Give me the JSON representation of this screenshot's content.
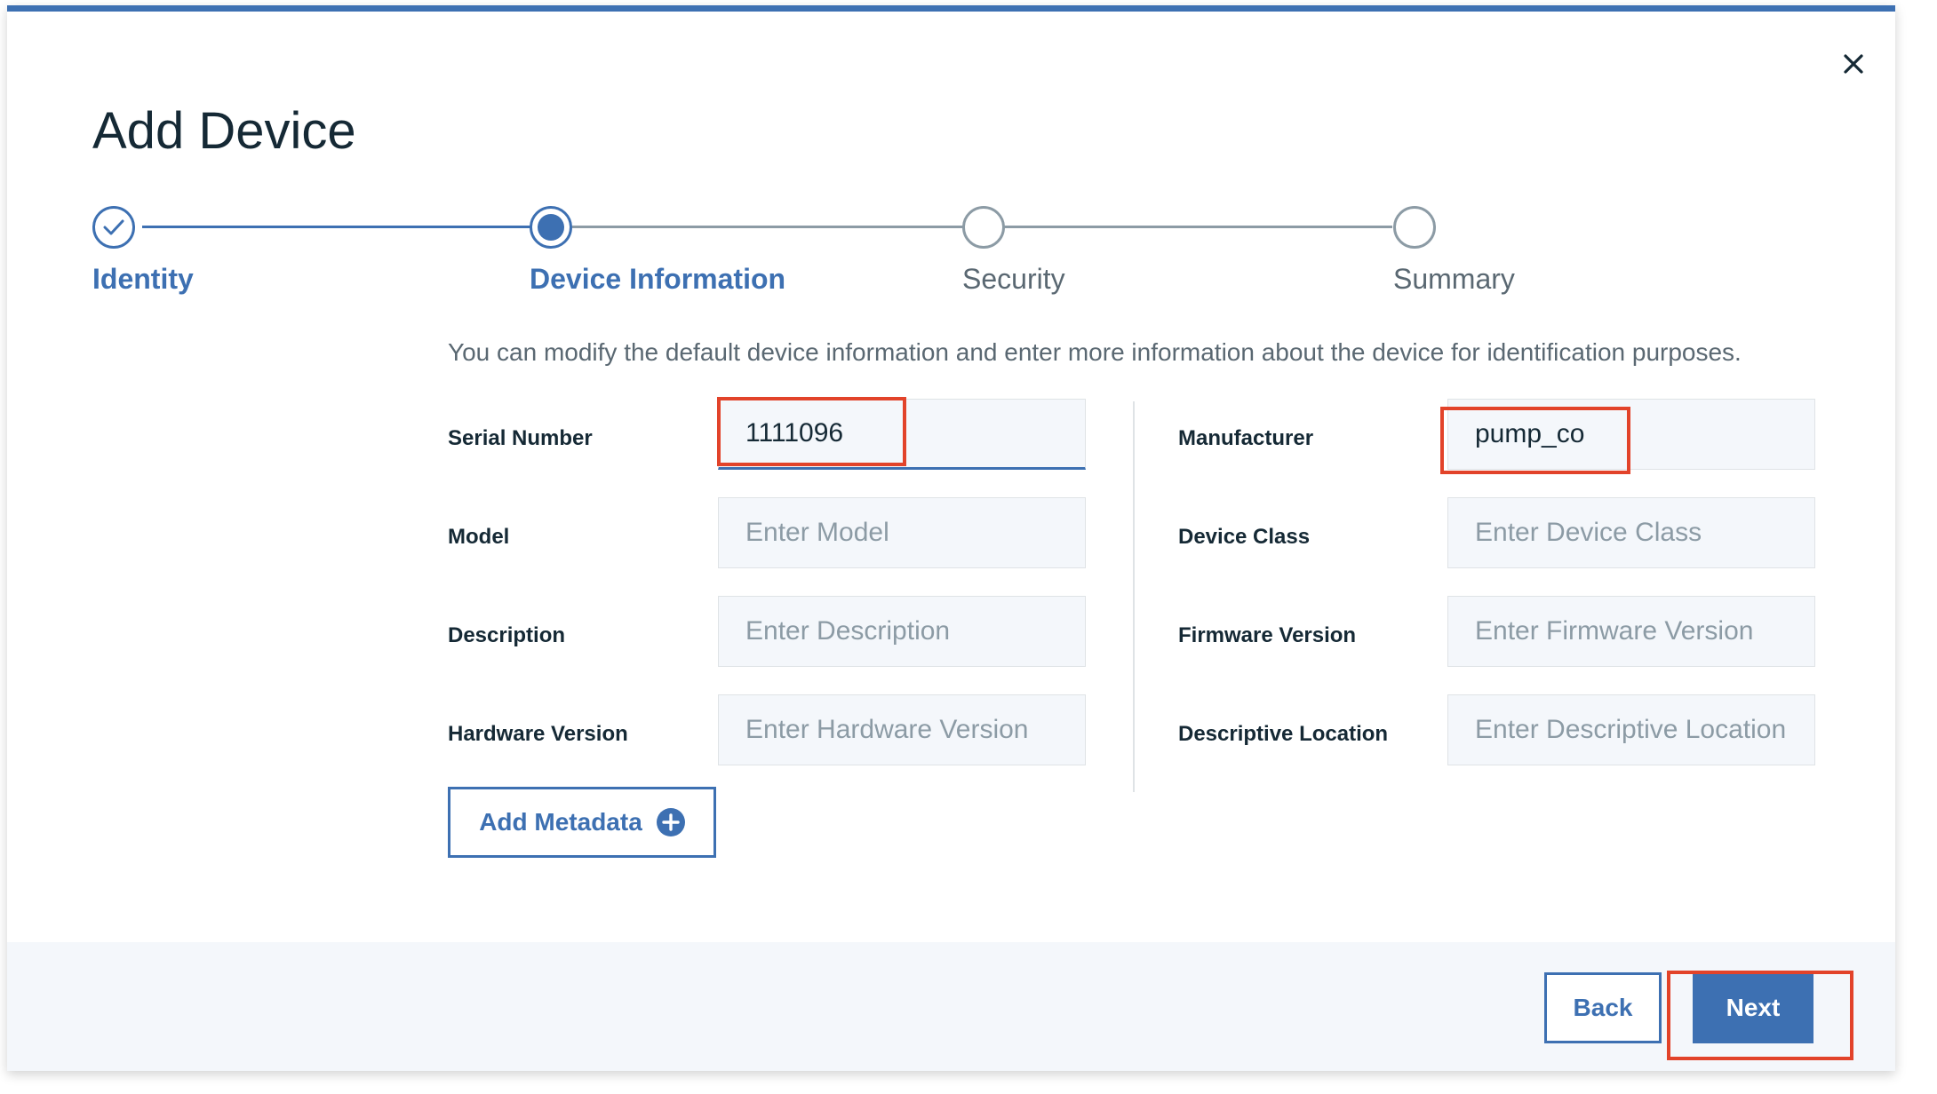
{
  "modal": {
    "title": "Add Device",
    "close_icon": "close-icon"
  },
  "steps": [
    {
      "label": "Identity",
      "state": "complete"
    },
    {
      "label": "Device Information",
      "state": "current"
    },
    {
      "label": "Security",
      "state": "incomplete"
    },
    {
      "label": "Summary",
      "state": "incomplete"
    }
  ],
  "intro": "You can modify the default device information and enter more information about the device for identification purposes.",
  "fields": {
    "serial_number": {
      "label": "Serial Number",
      "value": "1111096",
      "placeholder": ""
    },
    "model": {
      "label": "Model",
      "value": "",
      "placeholder": "Enter Model"
    },
    "description": {
      "label": "Description",
      "value": "",
      "placeholder": "Enter Description"
    },
    "hardware_version": {
      "label": "Hardware Version",
      "value": "",
      "placeholder": "Enter Hardware Version"
    },
    "manufacturer": {
      "label": "Manufacturer",
      "value": "pump_co",
      "placeholder": ""
    },
    "device_class": {
      "label": "Device Class",
      "value": "",
      "placeholder": "Enter Device Class"
    },
    "firmware_version": {
      "label": "Firmware Version",
      "value": "",
      "placeholder": "Enter Firmware Version"
    },
    "descriptive_location": {
      "label": "Descriptive Location",
      "value": "",
      "placeholder": "Enter Descriptive Location"
    }
  },
  "add_metadata": {
    "label": "Add Metadata",
    "icon": "plus-circle-icon"
  },
  "footer": {
    "back_label": "Back",
    "next_label": "Next"
  },
  "colors": {
    "accent": "#3d70b2",
    "highlight": "#e2432a",
    "field_bg": "#f4f7fb"
  }
}
